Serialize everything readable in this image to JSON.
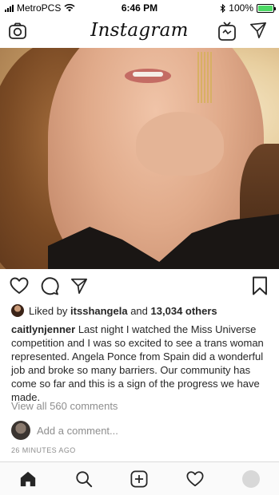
{
  "status_bar": {
    "carrier": "MetroPCS",
    "time": "6:46 PM",
    "battery_percent": "100%",
    "battery_level": 1.0,
    "battery_color": "#4cd964"
  },
  "header": {
    "logo_text": "Instagram",
    "icons": [
      "camera-icon",
      "igtv-icon",
      "direct-message-icon"
    ]
  },
  "post": {
    "actions": [
      "heart-icon",
      "comment-icon",
      "share-icon",
      "bookmark-icon"
    ],
    "liked_prefix": "Liked by",
    "liked_user": "itsshangela",
    "liked_conjunction": "and",
    "liked_others": "13,034 others",
    "caption_user": "caitlynjenner",
    "caption_text": "Last night I watched the Miss Universe competition and I was so excited to see a trans woman represented. Angela Ponce from Spain did a wonderful job and broke so many barriers. Our community has come so far and this is a sign of the progress we have made.",
    "view_comments": "View all 560 comments",
    "comment_placeholder": "Add a comment...",
    "timestamp": "26 MINUTES AGO"
  },
  "bottom_nav": {
    "items": [
      "home-icon",
      "search-icon",
      "new-post-icon",
      "activity-heart-icon",
      "profile-avatar"
    ]
  }
}
